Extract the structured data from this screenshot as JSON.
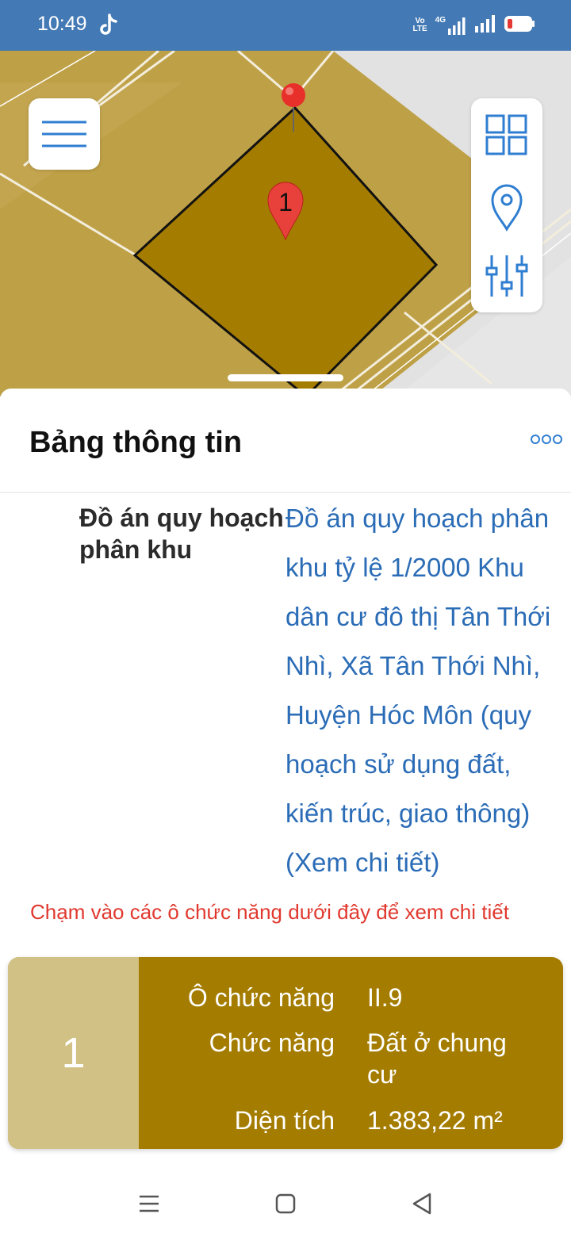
{
  "status_bar": {
    "time": "10:49",
    "volte_label": "Vo\nLTE",
    "network_label": "4G",
    "icons": [
      "tiktok-icon",
      "volte-icon",
      "signal-icon",
      "signal-icon",
      "battery-icon"
    ]
  },
  "map": {
    "marker_label": "1",
    "icons": [
      "menu-icon",
      "grid-icon",
      "location-pin-icon",
      "sliders-icon"
    ]
  },
  "sheet": {
    "title": "Bảng thông tin",
    "more_icon": "more-dots-icon",
    "plan_label": "Đồ án quy hoạch phân khu",
    "plan_value": "Đồ án quy hoạch phân khu tỷ lệ 1/2000 Khu dân cư đô thị Tân Thới Nhì, Xã Tân Thới Nhì, Huyện Hóc Môn (quy hoạch sử dụng đất, kiến trúc, giao thông) (Xem chi tiết)",
    "hint": "Chạm vào các ô chức năng dưới đây để xem chi tiết"
  },
  "plot_card": {
    "number": "1",
    "rows": [
      {
        "label": "Ô chức năng",
        "value": "II.9"
      },
      {
        "label": "Chức năng",
        "value": "Đất ở chung cư"
      },
      {
        "label": "Diện tích",
        "value": "1.383,22 m²"
      }
    ]
  },
  "nav_bar": {
    "icons": [
      "recent-apps-icon",
      "home-icon",
      "back-icon"
    ]
  },
  "colors": {
    "status_bar": "#4379b4",
    "map_land": "#bea046",
    "selected_plot": "#a47c00",
    "plot_number_bg": "#d2c185",
    "link_blue": "#2b6cb6",
    "hint_red": "#e0392f"
  }
}
